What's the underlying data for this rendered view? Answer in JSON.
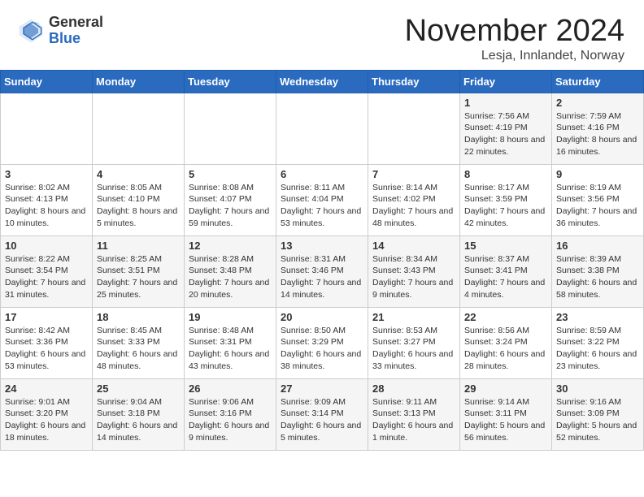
{
  "header": {
    "logo_general": "General",
    "logo_blue": "Blue",
    "month_title": "November 2024",
    "location": "Lesja, Innlandet, Norway"
  },
  "days_of_week": [
    "Sunday",
    "Monday",
    "Tuesday",
    "Wednesday",
    "Thursday",
    "Friday",
    "Saturday"
  ],
  "weeks": [
    [
      null,
      null,
      null,
      null,
      null,
      {
        "day": "1",
        "sunrise": "Sunrise: 7:56 AM",
        "sunset": "Sunset: 4:19 PM",
        "daylight": "Daylight: 8 hours and 22 minutes."
      },
      {
        "day": "2",
        "sunrise": "Sunrise: 7:59 AM",
        "sunset": "Sunset: 4:16 PM",
        "daylight": "Daylight: 8 hours and 16 minutes."
      }
    ],
    [
      {
        "day": "3",
        "sunrise": "Sunrise: 8:02 AM",
        "sunset": "Sunset: 4:13 PM",
        "daylight": "Daylight: 8 hours and 10 minutes."
      },
      {
        "day": "4",
        "sunrise": "Sunrise: 8:05 AM",
        "sunset": "Sunset: 4:10 PM",
        "daylight": "Daylight: 8 hours and 5 minutes."
      },
      {
        "day": "5",
        "sunrise": "Sunrise: 8:08 AM",
        "sunset": "Sunset: 4:07 PM",
        "daylight": "Daylight: 7 hours and 59 minutes."
      },
      {
        "day": "6",
        "sunrise": "Sunrise: 8:11 AM",
        "sunset": "Sunset: 4:04 PM",
        "daylight": "Daylight: 7 hours and 53 minutes."
      },
      {
        "day": "7",
        "sunrise": "Sunrise: 8:14 AM",
        "sunset": "Sunset: 4:02 PM",
        "daylight": "Daylight: 7 hours and 48 minutes."
      },
      {
        "day": "8",
        "sunrise": "Sunrise: 8:17 AM",
        "sunset": "Sunset: 3:59 PM",
        "daylight": "Daylight: 7 hours and 42 minutes."
      },
      {
        "day": "9",
        "sunrise": "Sunrise: 8:19 AM",
        "sunset": "Sunset: 3:56 PM",
        "daylight": "Daylight: 7 hours and 36 minutes."
      }
    ],
    [
      {
        "day": "10",
        "sunrise": "Sunrise: 8:22 AM",
        "sunset": "Sunset: 3:54 PM",
        "daylight": "Daylight: 7 hours and 31 minutes."
      },
      {
        "day": "11",
        "sunrise": "Sunrise: 8:25 AM",
        "sunset": "Sunset: 3:51 PM",
        "daylight": "Daylight: 7 hours and 25 minutes."
      },
      {
        "day": "12",
        "sunrise": "Sunrise: 8:28 AM",
        "sunset": "Sunset: 3:48 PM",
        "daylight": "Daylight: 7 hours and 20 minutes."
      },
      {
        "day": "13",
        "sunrise": "Sunrise: 8:31 AM",
        "sunset": "Sunset: 3:46 PM",
        "daylight": "Daylight: 7 hours and 14 minutes."
      },
      {
        "day": "14",
        "sunrise": "Sunrise: 8:34 AM",
        "sunset": "Sunset: 3:43 PM",
        "daylight": "Daylight: 7 hours and 9 minutes."
      },
      {
        "day": "15",
        "sunrise": "Sunrise: 8:37 AM",
        "sunset": "Sunset: 3:41 PM",
        "daylight": "Daylight: 7 hours and 4 minutes."
      },
      {
        "day": "16",
        "sunrise": "Sunrise: 8:39 AM",
        "sunset": "Sunset: 3:38 PM",
        "daylight": "Daylight: 6 hours and 58 minutes."
      }
    ],
    [
      {
        "day": "17",
        "sunrise": "Sunrise: 8:42 AM",
        "sunset": "Sunset: 3:36 PM",
        "daylight": "Daylight: 6 hours and 53 minutes."
      },
      {
        "day": "18",
        "sunrise": "Sunrise: 8:45 AM",
        "sunset": "Sunset: 3:33 PM",
        "daylight": "Daylight: 6 hours and 48 minutes."
      },
      {
        "day": "19",
        "sunrise": "Sunrise: 8:48 AM",
        "sunset": "Sunset: 3:31 PM",
        "daylight": "Daylight: 6 hours and 43 minutes."
      },
      {
        "day": "20",
        "sunrise": "Sunrise: 8:50 AM",
        "sunset": "Sunset: 3:29 PM",
        "daylight": "Daylight: 6 hours and 38 minutes."
      },
      {
        "day": "21",
        "sunrise": "Sunrise: 8:53 AM",
        "sunset": "Sunset: 3:27 PM",
        "daylight": "Daylight: 6 hours and 33 minutes."
      },
      {
        "day": "22",
        "sunrise": "Sunrise: 8:56 AM",
        "sunset": "Sunset: 3:24 PM",
        "daylight": "Daylight: 6 hours and 28 minutes."
      },
      {
        "day": "23",
        "sunrise": "Sunrise: 8:59 AM",
        "sunset": "Sunset: 3:22 PM",
        "daylight": "Daylight: 6 hours and 23 minutes."
      }
    ],
    [
      {
        "day": "24",
        "sunrise": "Sunrise: 9:01 AM",
        "sunset": "Sunset: 3:20 PM",
        "daylight": "Daylight: 6 hours and 18 minutes."
      },
      {
        "day": "25",
        "sunrise": "Sunrise: 9:04 AM",
        "sunset": "Sunset: 3:18 PM",
        "daylight": "Daylight: 6 hours and 14 minutes."
      },
      {
        "day": "26",
        "sunrise": "Sunrise: 9:06 AM",
        "sunset": "Sunset: 3:16 PM",
        "daylight": "Daylight: 6 hours and 9 minutes."
      },
      {
        "day": "27",
        "sunrise": "Sunrise: 9:09 AM",
        "sunset": "Sunset: 3:14 PM",
        "daylight": "Daylight: 6 hours and 5 minutes."
      },
      {
        "day": "28",
        "sunrise": "Sunrise: 9:11 AM",
        "sunset": "Sunset: 3:13 PM",
        "daylight": "Daylight: 6 hours and 1 minute."
      },
      {
        "day": "29",
        "sunrise": "Sunrise: 9:14 AM",
        "sunset": "Sunset: 3:11 PM",
        "daylight": "Daylight: 5 hours and 56 minutes."
      },
      {
        "day": "30",
        "sunrise": "Sunrise: 9:16 AM",
        "sunset": "Sunset: 3:09 PM",
        "daylight": "Daylight: 5 hours and 52 minutes."
      }
    ]
  ]
}
